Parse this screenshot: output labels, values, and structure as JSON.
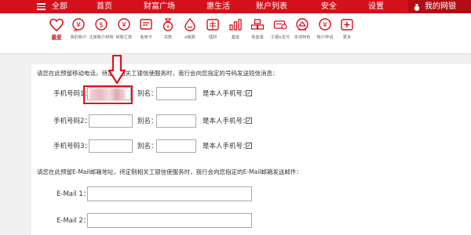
{
  "topnav": {
    "items": [
      "全部",
      "首页",
      "财富广场",
      "惠生活",
      "账户列表",
      "安全",
      "设置"
    ],
    "my_netbank": "我的网银"
  },
  "iconbar": {
    "items": [
      {
        "label": "最爱",
        "icon": "heart-icon"
      },
      {
        "label": "我的账户",
        "icon": "account-coin-icon"
      },
      {
        "label": "注册账户转账",
        "icon": "transfer-coin-icon"
      },
      {
        "label": "转账汇款",
        "icon": "remit-coin-icon"
      },
      {
        "label": "信用卡",
        "icon": "credit-card-icon"
      },
      {
        "label": "贷款",
        "icon": "loan-bag-icon"
      },
      {
        "label": "e缴费",
        "icon": "payment-drop-icon"
      },
      {
        "label": "理财",
        "icon": "finance-box-icon"
      },
      {
        "label": "基金",
        "icon": "fund-chart-icon"
      },
      {
        "label": "贵金属",
        "icon": "precious-metal-icon"
      },
      {
        "label": "工银e支付",
        "icon": "epay-icon"
      },
      {
        "label": "本地特色",
        "icon": "local-feature-icon"
      },
      {
        "label": "账户申请",
        "icon": "account-apply-icon"
      },
      {
        "label": "更多",
        "icon": "plus-box-icon"
      }
    ]
  },
  "form": {
    "phone_notice": "请您在此预留移动电话，待定制相关工银信使服务时，我行会向您指定的号码发送短信消息：",
    "phone_rows": [
      {
        "label": "手机号码1：",
        "alias": "别名：",
        "own": "是本人手机号：",
        "checked": "✓"
      },
      {
        "label": "手机号码2：",
        "alias": "别名：",
        "own": "是本人手机号：",
        "checked": "✓"
      },
      {
        "label": "手机号码3：",
        "alias": "别名：",
        "own": "是本人手机号：",
        "checked": "✓"
      }
    ],
    "email_notice": "请您在此预留E-Mail邮箱地址，待定制相关工银信使服务时，我行会向您指定的E-Mail邮箱发送邮件：",
    "email_rows": [
      {
        "label": "E-Mail 1："
      },
      {
        "label": "E-Mail 2："
      }
    ]
  },
  "colors": {
    "brand_red": "#d4111b",
    "highlight_red": "#e0121c"
  }
}
